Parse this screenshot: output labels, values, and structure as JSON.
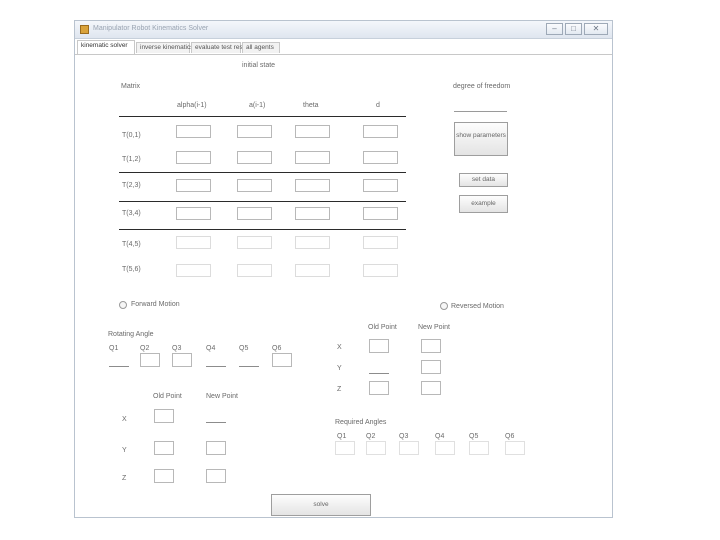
{
  "window": {
    "title": "Manipulator Robot Kinematics Solver"
  },
  "tabs": [
    "kinematic solver",
    "inverse kinematics",
    "evaluate test results",
    "all agents"
  ],
  "initial_state_label": "initial state",
  "matrix_label": "Matrix",
  "columns": [
    "alpha(i-1)",
    "a(i-1)",
    "theta",
    "d"
  ],
  "rows": [
    "T(0,1)",
    "T(1,2)",
    "T(2,3)",
    "T(3,4)",
    "T(4,5)",
    "T(5,6)"
  ],
  "dof": {
    "label": "degree of freedom",
    "value": ""
  },
  "buttons": {
    "show_parameters": "show parameters",
    "set_data": "set data",
    "example": "example",
    "solve": "solve"
  },
  "motion": {
    "forward": "Forward Motion",
    "reversed": "Reversed Motion"
  },
  "rotating_angle": {
    "label": "Rotating Angle",
    "angles": [
      "Q1",
      "Q2",
      "Q3",
      "Q4",
      "Q5",
      "Q6"
    ]
  },
  "right_points": {
    "old": "Old Point",
    "new": "New Point",
    "axes": [
      "X",
      "Y",
      "Z"
    ]
  },
  "left_points": {
    "old": "Old Point",
    "new": "New Point",
    "axes": [
      "X",
      "Y",
      "Z"
    ]
  },
  "required_angles": {
    "label": "Required Angles",
    "angles": [
      "Q1",
      "Q2",
      "Q3",
      "Q4",
      "Q5",
      "Q6"
    ]
  }
}
